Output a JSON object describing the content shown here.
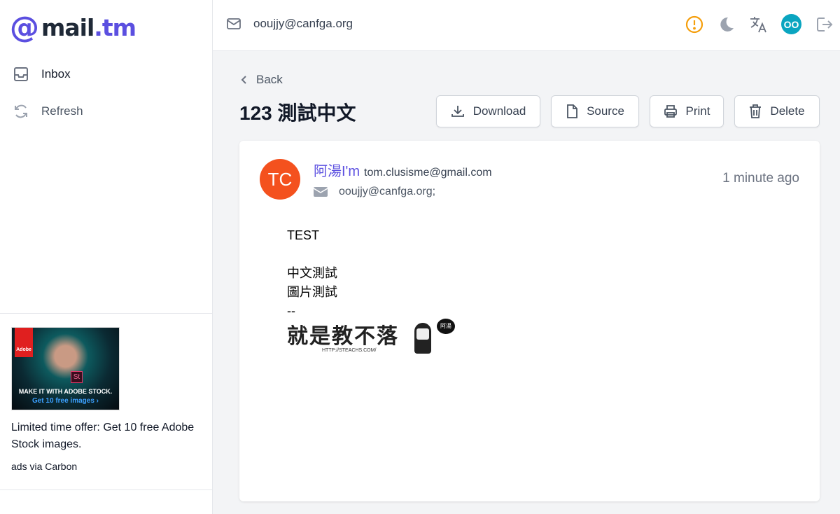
{
  "logo": {
    "at": "@",
    "mail": "mail",
    "tm": ".tm"
  },
  "sidebar": {
    "items": [
      {
        "label": "Inbox",
        "icon": "inbox-icon"
      },
      {
        "label": "Refresh",
        "icon": "refresh-icon"
      }
    ]
  },
  "ad": {
    "image_line1": "MAKE IT WITH ADOBE STOCK.",
    "image_line2": "Get 10 free images ›",
    "image_logo": "Adobe",
    "image_badge": "St",
    "text": "Limited time offer: Get 10 free Adobe Stock images.",
    "via": "ads via Carbon"
  },
  "header": {
    "address": "ooujjy@canfga.org",
    "avatar": "OO"
  },
  "message": {
    "back": "Back",
    "subject": "123 測試中文",
    "actions": {
      "download": "Download",
      "source": "Source",
      "print": "Print",
      "delete": "Delete"
    },
    "avatar": "TC",
    "from_name": "阿湯I'm",
    "from_email": "tom.clusisme@gmail.com",
    "to": "ooujjy@canfga.org;",
    "time": "1 minute ago",
    "body": [
      "TEST",
      "",
      "中文測試",
      "圖片測試",
      "--"
    ],
    "signature": {
      "title": "就是教不落",
      "url": "HTTP://STEACHS.COM/",
      "bubble": "阿湯"
    }
  },
  "colors": {
    "brand": "#5b4fe0",
    "avatar": "#f4511e",
    "warning": "#f59e0b",
    "user": "#0aa5c0"
  }
}
